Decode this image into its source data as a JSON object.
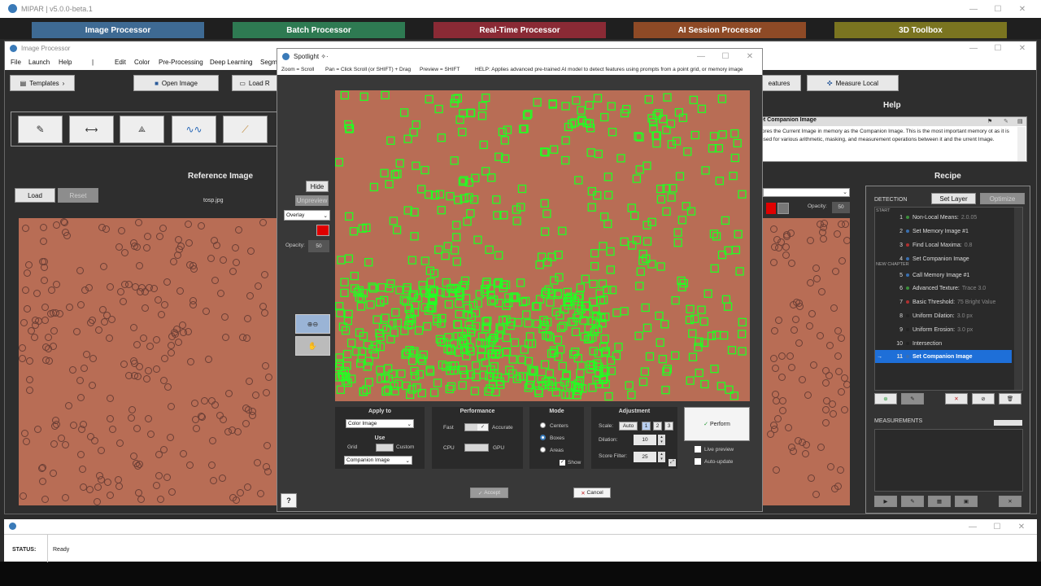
{
  "app": {
    "title": "MIPAR  |  v5.0.0-beta.1"
  },
  "modules": [
    {
      "label": "Image Processor",
      "color": "#3e6a93"
    },
    {
      "label": "Batch Processor",
      "color": "#2e7a52"
    },
    {
      "label": "Real-Time Processor",
      "color": "#8a2a35"
    },
    {
      "label": "AI Session Processor",
      "color": "#8e4a26"
    },
    {
      "label": "3D Toolbox",
      "color": "#7a7420"
    }
  ],
  "ip": {
    "title": "Image Processor",
    "menu": [
      "File",
      "Launch",
      "Help",
      "|",
      "Edit",
      "Color",
      "Pre-Processing",
      "Deep Learning",
      "Segm"
    ],
    "templates_label": "Templates",
    "open_image_label": "Open Image",
    "load_recipe_label": "Load R",
    "features_label": "eatures",
    "measure_local_label": "Measure Local",
    "help_title": "Help",
    "help_heading": "et Companion Image",
    "help_text": "tores the Current Image in memory as the Companion Image. This is the most important memory ot as it is used for various arithmetic, masking, and measurement operations between it and the urrent Image.",
    "reference_title": "Reference Image",
    "load_label": "Load",
    "reset_label": "Reset",
    "filename": "tosp.jpg",
    "recipe_title": "Recipe",
    "detection_label": "DETECTION",
    "set_layer_label": "Set Layer",
    "optimize_label": "Optimize",
    "opacity_label": "Opacity:",
    "opacity_value": "50",
    "measurements_label": "MEASUREMENTS",
    "start_label": "START",
    "new_chapter_label": "NEW CHAPTER"
  },
  "recipe": [
    {
      "num": "1",
      "name": "Non-Local Means:",
      "param": "2.0.05",
      "dot": "#3c8f3c"
    },
    {
      "num": "2",
      "name": "Set Memory Image #1",
      "param": "",
      "dot": "#3a6fb0"
    },
    {
      "num": "3",
      "name": "Find Local Maxima:",
      "param": "0.8",
      "dot": "#b03030"
    },
    {
      "num": "4",
      "name": "Set Companion Image",
      "param": "",
      "dot": "#3a6fb0"
    },
    {
      "num": "5",
      "name": "Call Memory Image #1",
      "param": "",
      "dot": "#3a6fb0"
    },
    {
      "num": "6",
      "name": "Advanced Texture:",
      "param": "Trace 3.0",
      "dot": "#3c8f3c"
    },
    {
      "num": "7",
      "name": "Basic Threshold:",
      "param": "75 Bright Value",
      "dot": "#b03030"
    },
    {
      "num": "8",
      "name": "Uniform Dilation:",
      "param": "3.0 px",
      "dot": "#222"
    },
    {
      "num": "9",
      "name": "Uniform Erosion:",
      "param": "3.0 px",
      "dot": "#222"
    },
    {
      "num": "10",
      "name": "Intersection",
      "param": "",
      "dot": "#222"
    },
    {
      "num": "11",
      "name": "Set Companion Image",
      "param": "",
      "dot": "#3a6fb0"
    }
  ],
  "spotlight": {
    "title": "Spotlight ✧·",
    "help": [
      "Zoom = Scroll",
      "Pan = Click Scroll (or SHIFT) + Drag",
      "Preview = SHIFT",
      "HELP:  Applies advanced pre-trained AI model to detect features using prompts from a point grid, or memory image"
    ],
    "hide_label": "Hide",
    "unpreview_label": "Unpreview",
    "overlay_label": "Overlay",
    "opacity_label": "Opacity:",
    "opacity_value": "50",
    "apply_to_label": "Apply to",
    "apply_to_value": "Color Image",
    "use_label": "Use",
    "grid_label": "Grid",
    "custom_label": "Custom",
    "use_value": "Companion Image",
    "performance_label": "Performance",
    "fast_label": "Fast",
    "accurate_label": "Accurate",
    "cpu_label": "CPU",
    "gpu_label": "GPU",
    "mode_label": "Mode",
    "centers_label": "Centers",
    "boxes_label": "Boxes",
    "areas_label": "Areas",
    "show_label": "Show",
    "adjustment_label": "Adjustment",
    "scale_label": "Scale:",
    "auto_label": "Auto",
    "scale_options": [
      "1",
      "2",
      "3"
    ],
    "dilation_label": "Dilation:",
    "dilation_value": "10",
    "score_label": "Score Filter:",
    "score_value": "25",
    "perform_label": "Perform",
    "live_preview_label": "Live preview",
    "auto_update_label": "Auto-update",
    "accept_label": "Accept",
    "cancel_label": "Cancel",
    "help_button": "?"
  },
  "status": {
    "label": "STATUS:",
    "value": "Ready"
  },
  "colors": {
    "overlay_red": "#e00000",
    "box_green": "#22ff22",
    "selected_row": "#1e6fd8",
    "image_bg": "#b86d55"
  }
}
